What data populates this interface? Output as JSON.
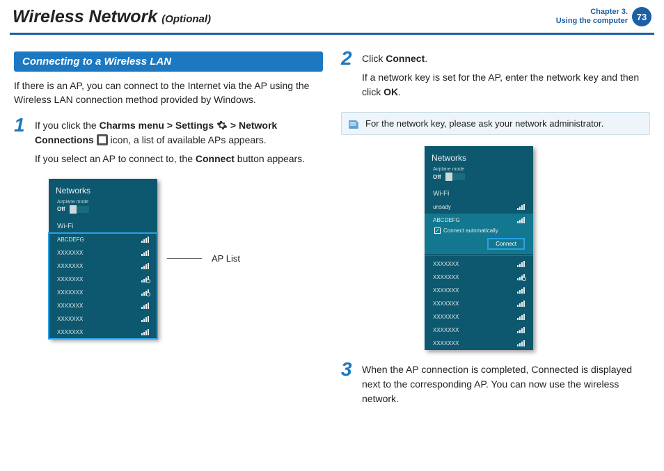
{
  "header": {
    "title_main": "Wireless Network",
    "title_sub": "(Optional)",
    "chapter_line1": "Chapter 3.",
    "chapter_line2": "Using the computer",
    "page_number": "73"
  },
  "left": {
    "section_title": "Connecting to a Wireless LAN",
    "intro": "If there is an AP, you can connect to the Internet via the AP using the Wireless LAN connection method provided by Windows.",
    "step1": {
      "num": "1",
      "p1a": "If you click the ",
      "p1b": "Charms menu > Settings ",
      "p1c": " > Network Connections ",
      "p1d": " icon, a list of available APs appears.",
      "p2a": "If you select an AP to connect to, the ",
      "p2b": "Connect",
      "p2c": " button appears."
    },
    "panel": {
      "title": "Networks",
      "airplane_label": "Airplane mode",
      "airplane_state": "Off",
      "wifi_label": "Wi-Fi",
      "aps": [
        "ABCDEFG",
        "XXXXXXX",
        "XXXXXXX",
        "XXXXXXX",
        "XXXXXXX",
        "XXXXXXX",
        "XXXXXXX",
        "XXXXXXX"
      ]
    },
    "callout": "AP List"
  },
  "right": {
    "step2": {
      "num": "2",
      "p1a": "Click ",
      "p1b": "Connect",
      "p1c": ".",
      "p2a": "If a network key is set for the AP, enter the network key and then click ",
      "p2b": "OK",
      "p2c": "."
    },
    "note": "For the network key, please ask your network administrator.",
    "panel": {
      "title": "Networks",
      "airplane_label": "Airplane mode",
      "airplane_state": "Off",
      "wifi_label": "Wi-Fi",
      "unsady": "unsady",
      "selected_ap": "ABCDEFG",
      "connect_auto": "Connect automatically",
      "connect_btn": "Connect",
      "aps_below": [
        "XXXXXXX",
        "XXXXXXX",
        "XXXXXXX",
        "XXXXXXX",
        "XXXXXXX",
        "XXXXXXX",
        "XXXXXXX"
      ]
    },
    "step3": {
      "num": "3",
      "text": "When the AP connection is completed, Connected is displayed next to the corresponding AP. You can now use the wireless network."
    }
  }
}
